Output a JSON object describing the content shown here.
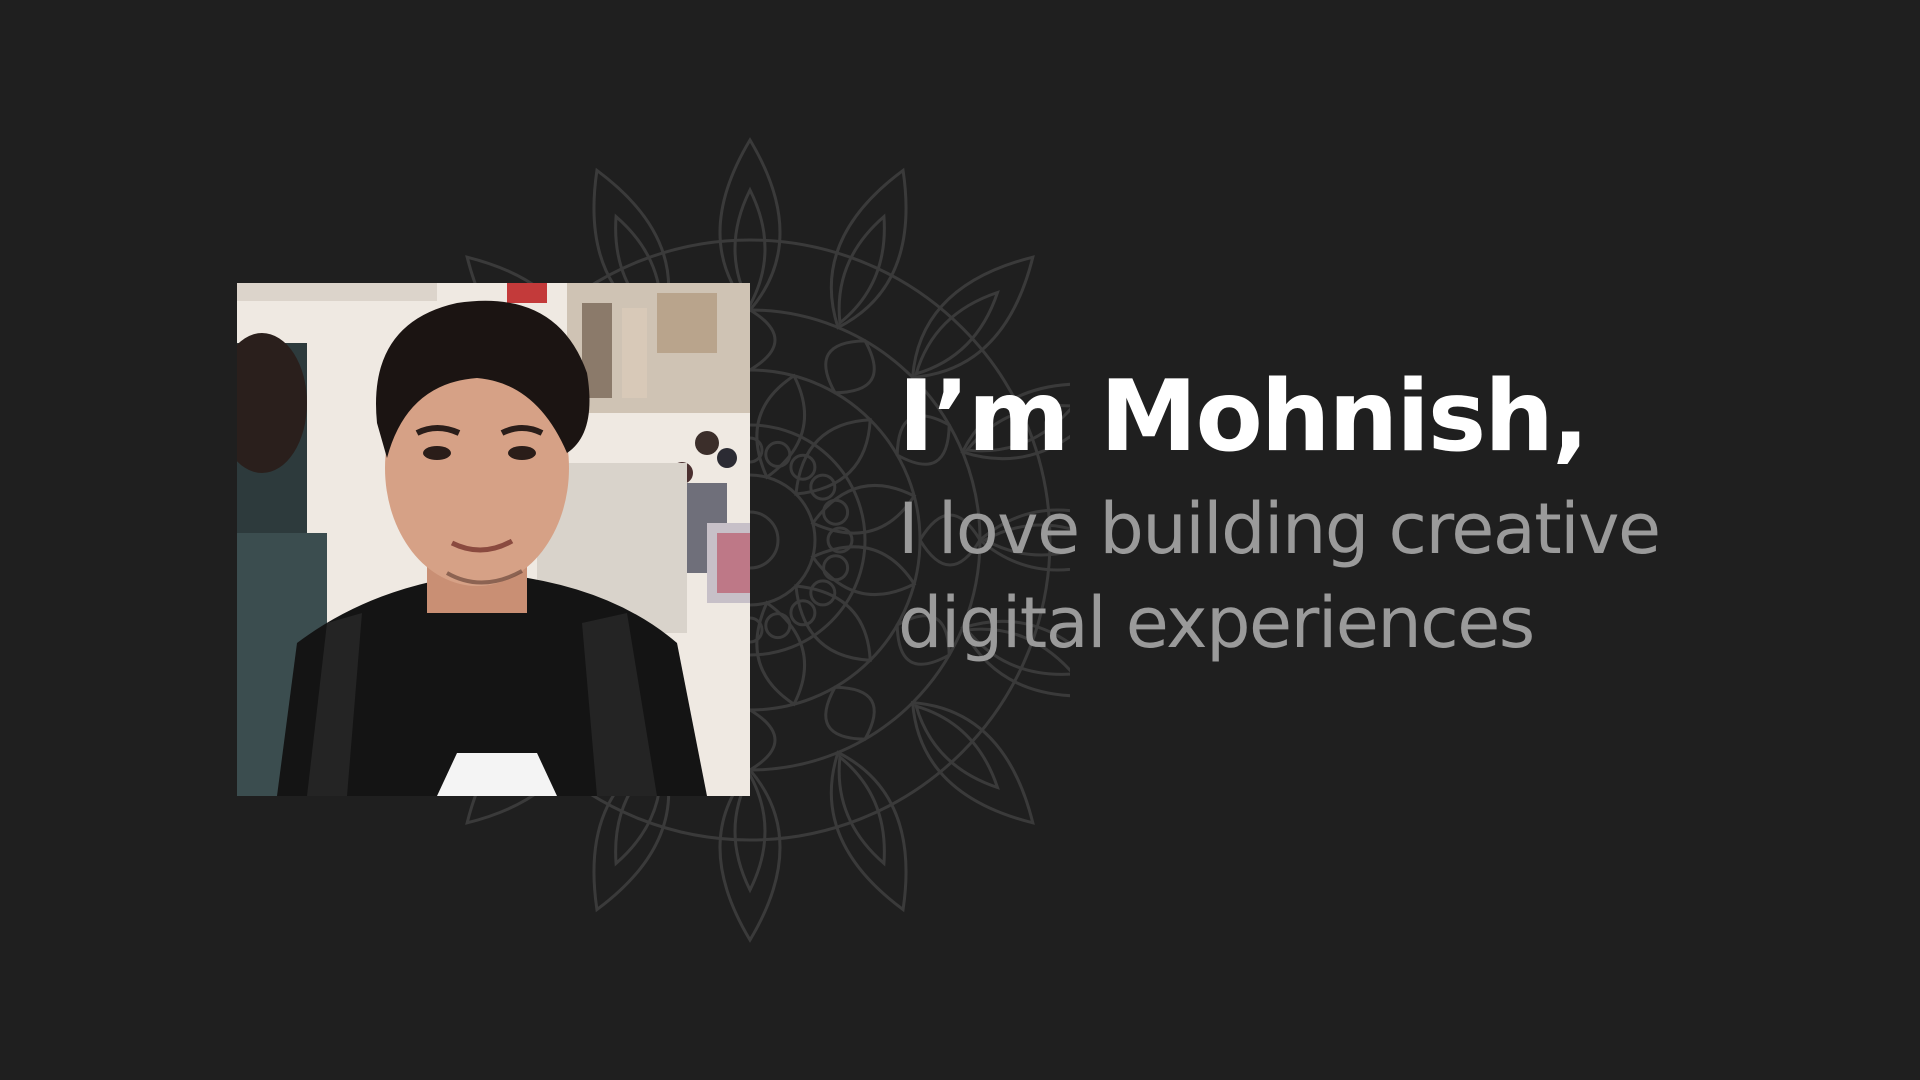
{
  "page": {
    "background_color": "#1f1f1f"
  },
  "hero": {
    "greeting": "I’m Mohnish,",
    "tagline_line1": "I love building creative",
    "tagline_line2": "digital experiences",
    "greeting_color": "#ffffff",
    "tagline_color": "#9a9a9a"
  },
  "decoration": {
    "icon": "mandala-icon",
    "stroke_color": "#3a3a3a"
  },
  "profile_photo": {
    "icon": "profile-photo"
  }
}
